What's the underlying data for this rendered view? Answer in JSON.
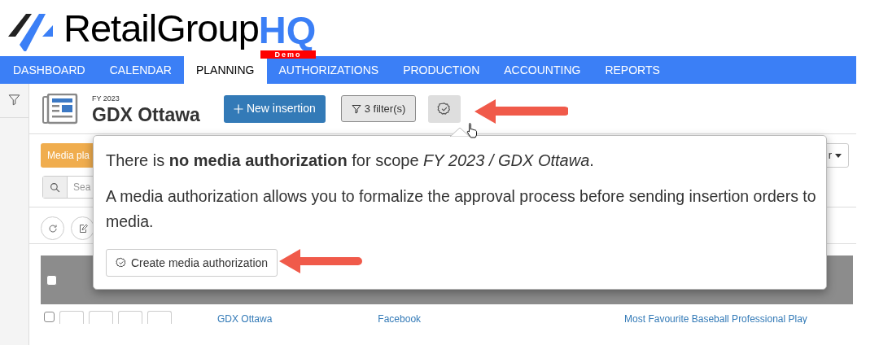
{
  "logo": {
    "name": "RetailGroup",
    "accent": "HQ",
    "badge": "Demo"
  },
  "nav": [
    {
      "label": "DASHBOARD",
      "selected": false
    },
    {
      "label": "CALENDAR",
      "selected": false
    },
    {
      "label": "PLANNING",
      "selected": true
    },
    {
      "label": "AUTHORIZATIONS",
      "selected": false
    },
    {
      "label": "PRODUCTION",
      "selected": false
    },
    {
      "label": "ACCOUNTING",
      "selected": false
    },
    {
      "label": "REPORTS",
      "selected": false
    }
  ],
  "header": {
    "year": "FY 2023",
    "title": "GDX Ottawa",
    "new_button": "New insertion",
    "filter_button": "3 filter(s)"
  },
  "toolbar": {
    "media_button": "Media pla",
    "search_placeholder": "Sea",
    "dropdown": "r"
  },
  "table": {
    "header_checked": false,
    "rows": [
      {
        "checked": false,
        "cells": [
          "GDX Ottawa",
          "Facebook",
          "Most Favourite Baseball Professional Play"
        ]
      }
    ]
  },
  "popover": {
    "message": "There is **no media authorization** for scope *FY 2023 / GDX Ottawa*.",
    "description": "A media authorization allows you to formalize the approval process before sending insertion orders to media.",
    "button": "Create media authorization"
  }
}
